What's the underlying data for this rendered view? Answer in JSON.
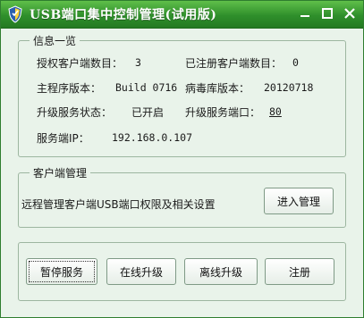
{
  "window": {
    "title": "USB端口集中控制管理(试用版)",
    "app_icon": "shield-icon",
    "controls": {
      "minimize": "minimize-icon",
      "maximize": "maximize-icon",
      "close": "close-icon"
    }
  },
  "info": {
    "group_title": "信息一览",
    "licensed_clients_label": "授权客户端数目：",
    "licensed_clients_value": "3",
    "registered_clients_label": "已注册客户端数目：",
    "registered_clients_value": "0",
    "main_version_label": "主程序版本：",
    "main_version_value": "Build 0716",
    "virus_db_version_label": "病毒库版本：",
    "virus_db_version_value": "20120718",
    "upgrade_status_label": "升级服务状态：",
    "upgrade_status_value": "已开启",
    "upgrade_port_label": "升级服务端口：",
    "upgrade_port_value": "80",
    "server_ip_label": "服务端IP：",
    "server_ip_value": "192.168.0.107"
  },
  "client": {
    "group_title": "客户端管理",
    "description": "远程管理客户端USB端口权限及相关设置",
    "enter_button": "进入管理"
  },
  "actions": {
    "pause_service": "暂停服务",
    "online_upgrade": "在线升级",
    "offline_upgrade": "离线升级",
    "register": "注册"
  },
  "colors": {
    "titlebar": "#2f8f2b",
    "background": "#e9f3ea"
  }
}
